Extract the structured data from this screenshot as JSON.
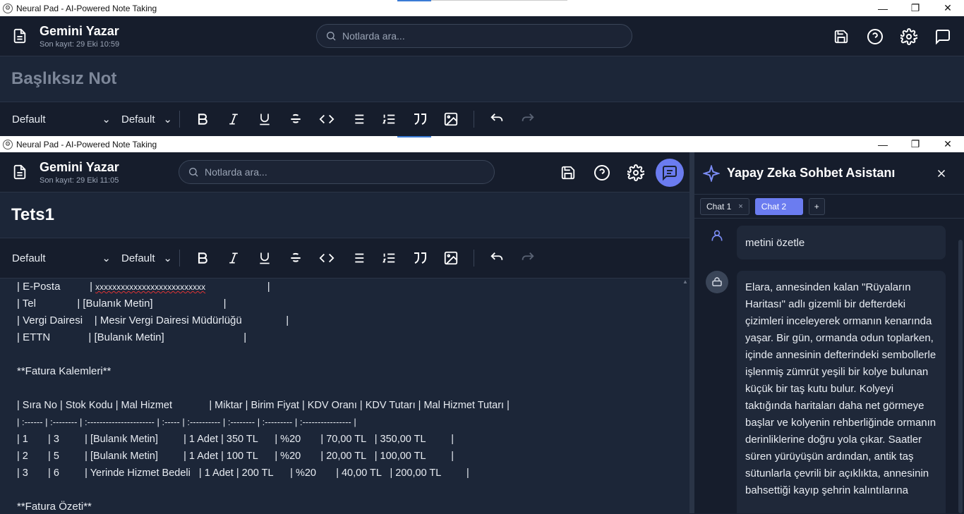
{
  "back_window": {
    "title": "Neural Pad - AI-Powered Note Taking",
    "brand_name": "Gemini Yazar",
    "saved": "Son kayıt: 29 Eki 10:59",
    "search_placeholder": "Notlarda ara...",
    "note_title": "Başlıksız Not",
    "font_select": "Default",
    "size_select": "Default"
  },
  "front_window": {
    "title": "Neural Pad - AI-Powered Note Taking",
    "brand_name": "Gemini Yazar",
    "saved": "Son kayıt: 29 Eki 11:05",
    "search_placeholder": "Notlarda ara...",
    "note_title": "Tets1",
    "font_select": "Default",
    "size_select": "Default",
    "editor_lines": [
      "| E-Posta          | ",
      "| Tel              | [Bulanık Metin]                        |",
      "| Vergi Dairesi    | Mesir Vergi Dairesi Müdürlüğü               |",
      "| ETTN             | [Bulanık Metin]                           |",
      "",
      "**Fatura Kalemleri**",
      "",
      "| Sıra No | Stok Kodu | Mal Hizmet             | Miktar | Birim Fiyat | KDV Oranı | KDV Tutarı | Mal Hizmet Tutarı |",
      "| :------ | :-------- | :---------------------- | :----- | :---------- | :-------- | :--------- | :---------------- |",
      "| 1       | 3         | [Bulanık Metin]         | 1 Adet | 350 TL      | %20       | 70,00 TL   | 350,00 TL         |",
      "| 2       | 5         | [Bulanık Metin]         | 1 Adet | 100 TL      | %20       | 20,00 TL   | 100,00 TL         |",
      "| 3       | 6         | Yerinde Hizmet Bedeli   | 1 Adet | 200 TL      | %20       | 40,00 TL   | 200,00 TL         |",
      "",
      "**Fatura Özeti**"
    ],
    "email_value": "xxxxxxxxxxxxxxxxxxxxxxxxxx",
    "email_tail": "                     |"
  },
  "chat": {
    "title": "Yapay Zeka Sohbet Asistanı",
    "tabs": [
      {
        "label": "Chat 1",
        "close": "×"
      },
      {
        "label": "Chat 2"
      }
    ],
    "add_tab": "+",
    "user_message": "metini özetle",
    "ai_message": "Elara, annesinden kalan \"Rüyaların Haritası\" adlı gizemli bir defterdeki çizimleri inceleyerek ormanın kenarında yaşar. Bir gün, ormanda odun toplarken, içinde annesinin defterindeki sembollerle işlenmiş zümrüt yeşili bir kolye bulunan küçük bir taş kutu bulur. Kolyeyi taktığında haritaları daha net görmeye başlar ve kolyenin rehberliğinde ormanın derinliklerine doğru yola çıkar. Saatler süren yürüyüşün ardından, antik taş sütunlarla çevrili bir açıklıkta, annesinin bahsettiği kayıp şehrin kalıntılarına"
  },
  "window_controls": {
    "minimize": "—",
    "restore": "❐",
    "close": "✕"
  },
  "colors": {
    "accent": "#6b7cf0",
    "bg": "#161d2c",
    "editor_bg": "#1c2638"
  }
}
